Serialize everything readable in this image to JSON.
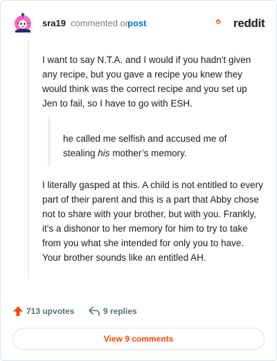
{
  "header": {
    "username": "sra19",
    "action_text": "commented on",
    "post_link": "post",
    "brand": "reddit"
  },
  "comment": {
    "paragraph1": "I want to say N.T.A. and I would if you hadn't given any recipe, but you gave a recipe you knew they would think was the correct recipe and you set up Jen to fail, so I have to go with ESH.",
    "quote_before": "he called me selfish and accused me of stealing ",
    "quote_emph": "his",
    "quote_after": " mother’s memory.",
    "paragraph2": "I literally gasped at this. A child is not entitled to every part of their parent and this is a part that Abby chose not to share with your brother, but with you. Frankly, it's a dishonor to her memory for him to try to take from you what she intended for only you to have. Your brother sounds like an entitled AH."
  },
  "footer": {
    "upvotes": "713 upvotes",
    "replies": "9 replies",
    "view_comments": "View 9 comments"
  },
  "colors": {
    "brand": "#ff4500",
    "link": "#0079d3",
    "muted": "#7c7c7c"
  },
  "icons": [
    "avatar",
    "reddit-logo-icon",
    "upvote-arrow-icon",
    "reply-icon"
  ]
}
